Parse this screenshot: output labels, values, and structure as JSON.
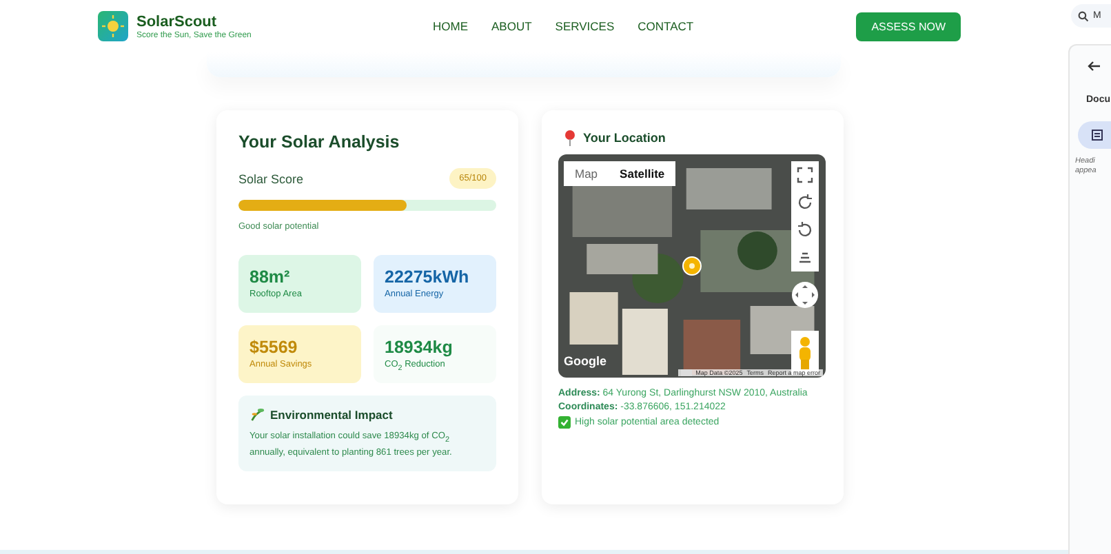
{
  "header": {
    "brand": "SolarScout",
    "tagline": "Score the Sun, Save the Green",
    "nav": [
      {
        "label": "HOME"
      },
      {
        "label": "ABOUT"
      },
      {
        "label": "SERVICES"
      },
      {
        "label": "CONTACT"
      }
    ],
    "cta": "ASSESS NOW"
  },
  "analysis": {
    "title": "Your Solar Analysis",
    "score_label": "Solar Score",
    "score_badge": "65/100",
    "level": 0.65,
    "score_note": "Good solar potential",
    "stats": [
      {
        "value": "88m²",
        "label": "Rooftop Area",
        "kind": "green"
      },
      {
        "value": "22275kWh",
        "label": "Annual Energy",
        "kind": "blue"
      },
      {
        "value": "$5569",
        "label": "Annual Savings",
        "kind": "yellow"
      },
      {
        "value": "18934kg",
        "label": "CO$_{2}$ Reduction",
        "kind": "plain"
      }
    ],
    "impact": {
      "title": "Environmental Impact",
      "text": "Your solar installation could save 18934kg of CO$_{2}$ annually, equivalent to planting 861 trees per year."
    }
  },
  "location": {
    "title": "Your Location",
    "map": {
      "tabs": [
        {
          "label": "Map",
          "selected": false
        },
        {
          "label": "Satellite",
          "selected": true
        }
      ],
      "logo": "Google",
      "footer": [
        "Map Data ©2025",
        "Terms",
        "Report a map error"
      ]
    },
    "address_label": "Address:",
    "address": "64 Yurong St, Darlinghurst NSW 2010, Australia",
    "coords_label": "Coordinates:",
    "coords": "-33.876606, 151.214022",
    "status": "High solar potential area detected"
  },
  "side_panel": {
    "search": "M",
    "heading": "Docu",
    "note": [
      "Headi",
      "appea"
    ]
  }
}
